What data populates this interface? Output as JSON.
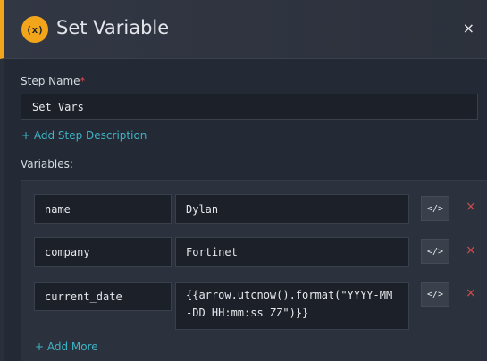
{
  "header": {
    "icon_text": "(x)",
    "title": "Set Variable",
    "close_glyph": "×"
  },
  "step_name": {
    "label": "Step Name",
    "required_mark": "*",
    "value": "Set Vars"
  },
  "add_description_label": "+ Add Step Description",
  "variables": {
    "label": "Variables:",
    "code_button_glyph": "</>",
    "remove_glyph": "×",
    "items": [
      {
        "name": "name",
        "value": "Dylan"
      },
      {
        "name": "company",
        "value": "Fortinet"
      },
      {
        "name": "current_date",
        "value": "{{arrow.utcnow().format(\"YYYY-MM-DD HH:mm:ss ZZ\")}}"
      }
    ],
    "add_more_label": "+ Add More"
  },
  "colors": {
    "accent": "#f2a51a",
    "link": "#3fb2c3",
    "danger": "#d04a4a",
    "background": "#232a35"
  }
}
